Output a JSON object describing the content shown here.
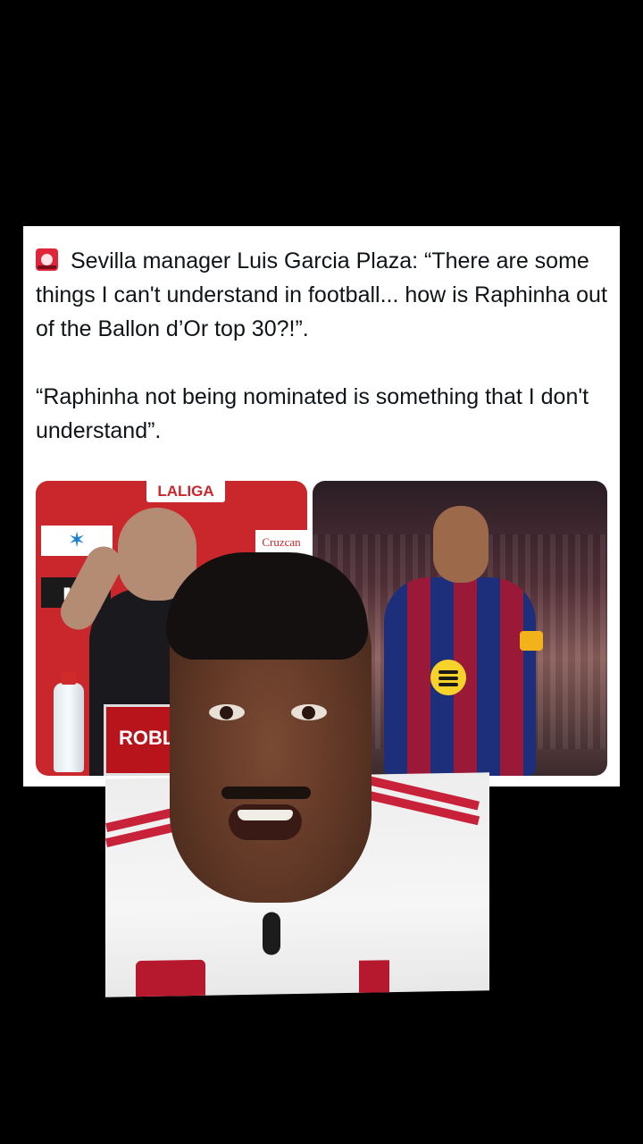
{
  "tweet": {
    "alert_icon": "rotating-light-emoji",
    "paragraph_1": "Sevilla manager Luis Garcia Plaza: “There are some things I can't understand in football... how is Raphinha out of the Ballon d’Or top 30?!”.",
    "paragraph_2": "“Raphinha not being nominated is something that I don't understand”."
  },
  "photo_left": {
    "laliga_label": "LALIGA",
    "sponsor_cruzcam": "Cruzcan",
    "sign_label": "ROBL"
  },
  "colors": {
    "background": "#000000",
    "card": "#ffffff",
    "text": "#0f1419",
    "accent_red": "#c9272c"
  }
}
